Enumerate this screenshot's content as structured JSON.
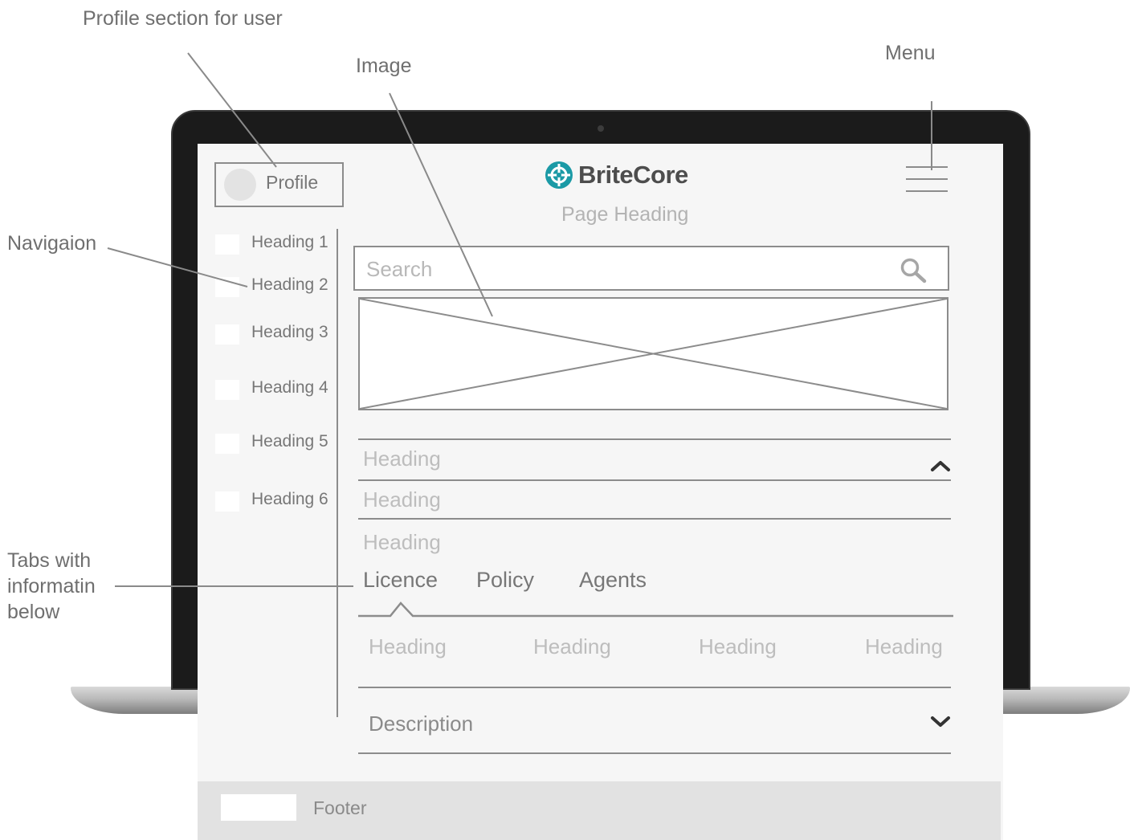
{
  "annotations": {
    "profile": "Profile section for user",
    "image": "Image",
    "menu": "Menu",
    "navigation": "Navigaion",
    "tabs_line1": "Tabs with",
    "tabs_line2": "informatin",
    "tabs_line3": "below"
  },
  "header": {
    "profile_label": "Profile",
    "logo_text": "BriteCore",
    "logo_color": "#1b9aa6",
    "menu_icon": "hamburger-icon",
    "page_heading": "Page Heading"
  },
  "sidebar": {
    "items": [
      {
        "label": "Heading 1"
      },
      {
        "label": "Heading 2"
      },
      {
        "label": "Heading 3"
      },
      {
        "label": "Heading 4"
      },
      {
        "label": "Heading 5"
      },
      {
        "label": "Heading 6"
      }
    ]
  },
  "search": {
    "placeholder": "Search",
    "icon": "search-icon"
  },
  "accordion": {
    "items": [
      {
        "label": "Heading",
        "icon": "chevron-up-icon"
      },
      {
        "label": "Heading"
      },
      {
        "label": "Heading"
      }
    ]
  },
  "tabs": {
    "items": [
      {
        "label": "Licence",
        "active": true
      },
      {
        "label": "Policy"
      },
      {
        "label": "Agents"
      }
    ],
    "columns": [
      "Heading",
      "Heading",
      "Heading",
      "Heading"
    ]
  },
  "description": {
    "label": "Description",
    "icon": "chevron-down-icon"
  },
  "footer": {
    "label": "Footer"
  }
}
